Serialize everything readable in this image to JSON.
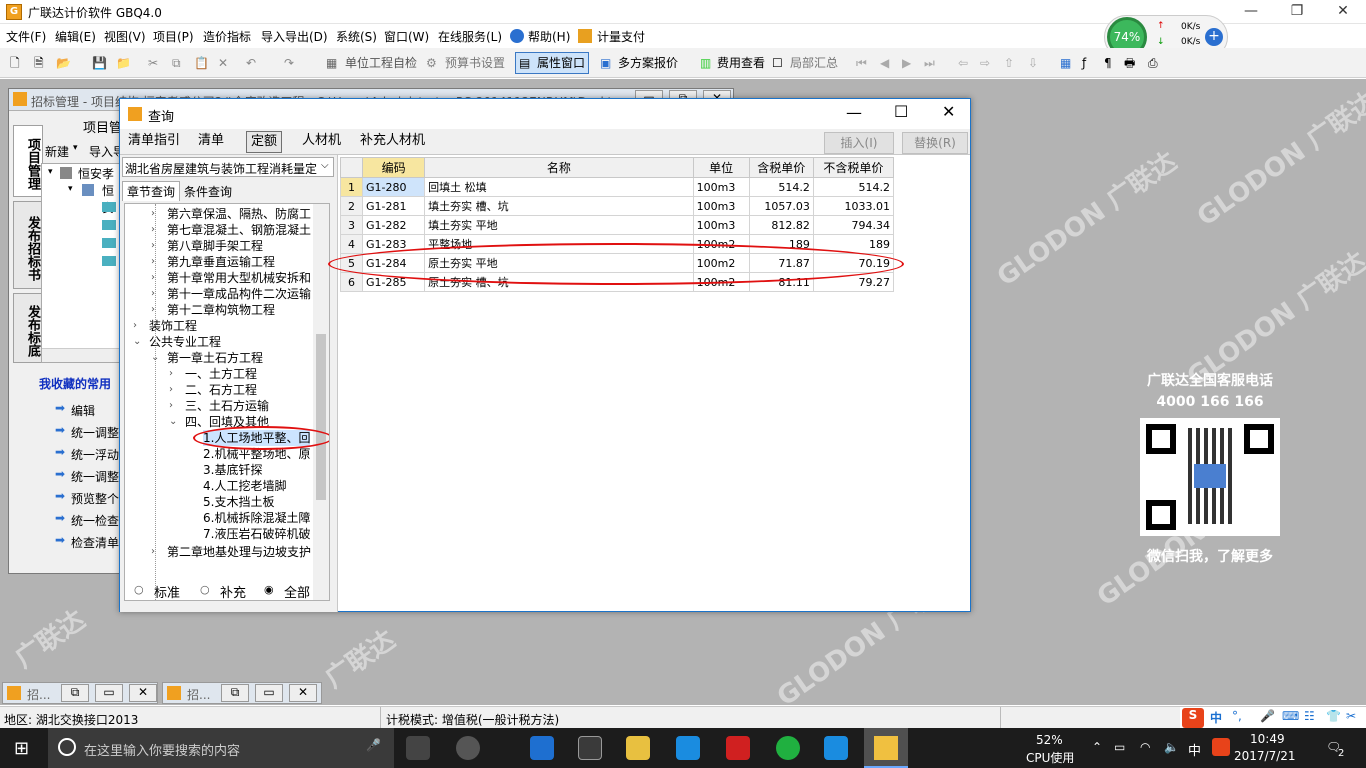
{
  "app": {
    "title": "广联达计价软件 GBQ4.0"
  },
  "menu": [
    "文件(F)",
    "编辑(E)",
    "视图(V)",
    "项目(P)",
    "造价指标",
    "导入导出(D)",
    "系统(S)",
    "窗口(W)",
    "在线服务(L)",
    "帮助(H)",
    "计量支付"
  ],
  "toolbar": {
    "self_check": "单位工程自检",
    "budget_settings": "预算书设置",
    "property_window": "属性窗口",
    "multi_quote": "多方案报价",
    "fee_view": "费用查看",
    "partial_summary": "局部汇总"
  },
  "netmon": {
    "percent": "74%",
    "up": "0K/s",
    "down": "0K/s"
  },
  "bgwin": {
    "title": "招标管理 - 项目结构 恒安孝感公司2#仓库改造工程 - C:\\Users\\Administrator-PC-20141127NRHM\\Deskto",
    "tabs": [
      "项目管理",
      "发布招标书",
      "发布标底"
    ],
    "project_mgmt": "项目管",
    "new_btn": "新建",
    "import_btn": "导入导",
    "tree_root": "恒安孝",
    "tree_child": "恒安",
    "fav_title": "我收藏的常用",
    "fav_items": [
      "编辑",
      "统一调整",
      "统一浮动",
      "统一调整",
      "预览整个",
      "统一检查",
      "检查清单"
    ]
  },
  "dialog": {
    "title": "查询",
    "tabs": [
      "清单指引",
      "清单",
      "定额",
      "人材机",
      "补充人材机"
    ],
    "insert": "插入(I)",
    "replace": "替换(R)",
    "dropdown": "湖北省房屋建筑与装饰工程消耗量定",
    "subtabs": [
      "章节查询",
      "条件查询"
    ],
    "tree": [
      "第六章保温、隔热、防腐工",
      "第七章混凝土、钢筋混凝土",
      "第八章脚手架工程",
      "第九章垂直运输工程",
      "第十章常用大型机械安拆和",
      "第十一章成品构件二次运输",
      "第十二章构筑物工程",
      "装饰工程",
      "公共专业工程",
      "第一章土石方工程",
      "一、土方工程",
      "二、石方工程",
      "三、土石方运输",
      "四、回填及其他",
      "1.人工场地平整、回",
      "2.机械平整场地、原",
      "3.基底钎探",
      "4.人工挖老墙脚",
      "5.支木挡土板",
      "6.机械拆除混凝土障",
      "7.液压岩石破碎机破",
      "第二章地基处理与边坡支护"
    ],
    "radios": [
      "标准",
      "补充",
      "全部"
    ],
    "columns": [
      "编码",
      "名称",
      "单位",
      "含税单价",
      "不含税单价"
    ],
    "rows": [
      [
        "1",
        "G1-280",
        "回填土 松填",
        "100m3",
        "514.2",
        "514.2"
      ],
      [
        "2",
        "G1-281",
        "填土夯实 槽、坑",
        "100m3",
        "1057.03",
        "1033.01"
      ],
      [
        "3",
        "G1-282",
        "填土夯实 平地",
        "100m3",
        "812.82",
        "794.34"
      ],
      [
        "4",
        "G1-283",
        "平整场地",
        "100m2",
        "189",
        "189"
      ],
      [
        "5",
        "G1-284",
        "原土夯实 平地",
        "100m2",
        "71.87",
        "70.19"
      ],
      [
        "6",
        "G1-285",
        "原土夯实 槽、坑",
        "100m2",
        "81.11",
        "79.27"
      ]
    ]
  },
  "brand": {
    "hotline_label": "广联达全国客服电话",
    "hotline": "4000 166 166",
    "wechat": "微信扫我，了解更多"
  },
  "minitabs": [
    "招...",
    "招..."
  ],
  "status": {
    "region": "地区: 湖北交换接口2013",
    "tax_mode": "计税模式: 增值税(一般计税方法)"
  },
  "taskbar": {
    "search": "在这里输入你要搜索的内容",
    "cpu_percent": "52%",
    "cpu_label": "CPU使用",
    "lang": "中",
    "time": "10:49",
    "date": "2017/7/21",
    "notif": "2"
  }
}
